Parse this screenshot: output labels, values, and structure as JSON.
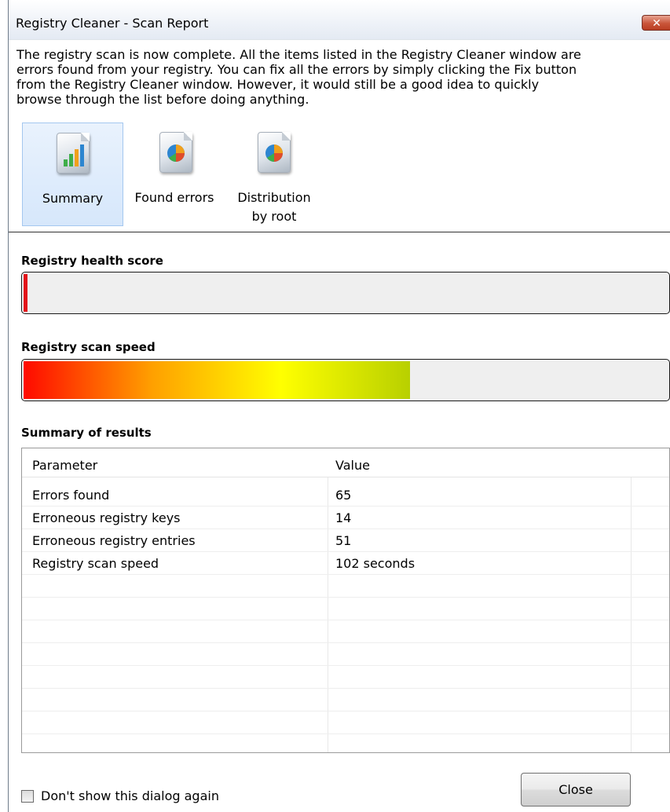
{
  "window": {
    "title": "Registry Cleaner - Scan Report",
    "close_glyph": "✕"
  },
  "intro_lines": [
    "The registry scan is now complete. All the items listed in the Registry Cleaner window are",
    "errors found from your registry. You can fix all the errors by simply clicking the Fix button",
    "from the Registry Cleaner window. However, it would still be a good idea to quickly",
    "browse through the list before doing anything."
  ],
  "nav": [
    {
      "label": "Summary",
      "icon": "bar-chart-document-icon",
      "selected": true
    },
    {
      "label": "Found errors",
      "icon": "pie-chart-document-icon",
      "selected": false
    },
    {
      "label_line1": "Distribution",
      "label_line2": "by root",
      "icon": "pie-chart-document-icon",
      "selected": false
    }
  ],
  "health": {
    "label": "Registry health score",
    "level_percent": 0.6,
    "color": "#e2141a"
  },
  "speed": {
    "label": "Registry scan speed",
    "level_percent": 60,
    "colors": [
      "#ff0a00",
      "#ffa000",
      "#ffff00",
      "#b8d000"
    ]
  },
  "summary": {
    "label": "Summary of results",
    "columns": [
      "Parameter",
      "Value"
    ],
    "rows": [
      [
        "Errors found",
        "65"
      ],
      [
        "Erroneous registry keys",
        "14"
      ],
      [
        "Erroneous registry entries",
        "51"
      ],
      [
        "Registry scan speed",
        "102 seconds"
      ]
    ]
  },
  "footer": {
    "checkbox_label": "Don't show this dialog again",
    "checked": false,
    "close_label": "Close"
  }
}
